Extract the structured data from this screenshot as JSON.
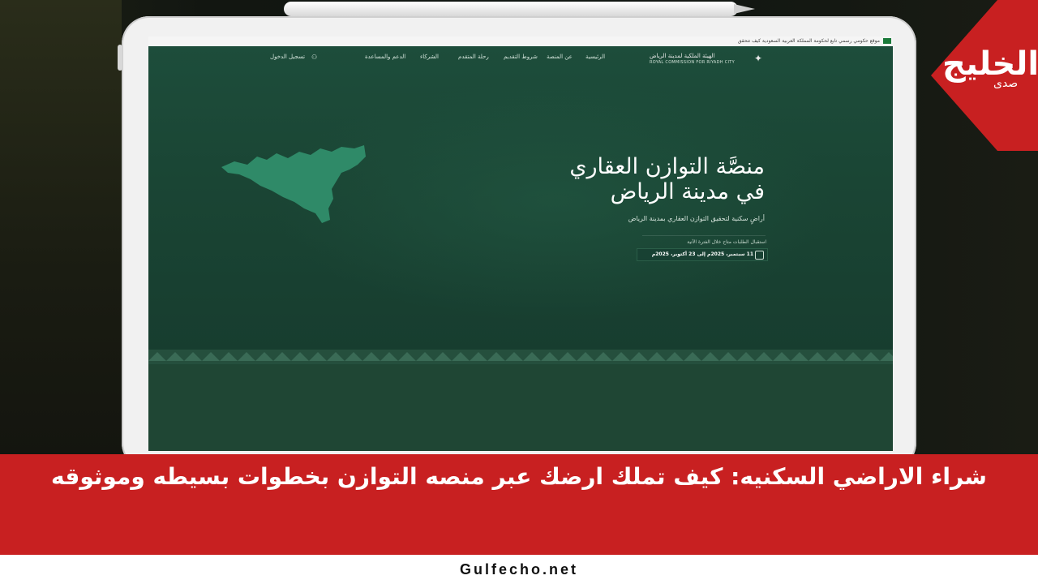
{
  "gov_bar": {
    "text": "موقع حكومي رسمي تابع لحكومة المملكة العربية السعودية  كيف تتحقق"
  },
  "nav": {
    "logo_ar": "الهيئة الملكية لمدينة الرياض",
    "logo_en": "ROYAL COMMISSION FOR RIYADH CITY",
    "items": [
      "الرئيسية",
      "عن المنصة",
      "شروط التقديم",
      "رحلة المتقدم",
      "الشركاء",
      "الدعم والمساعدة"
    ],
    "login": "تسجيل الدخول"
  },
  "hero": {
    "title_line1": "منصَّة التوازن العقاري",
    "title_line2": "في مدينة الرياض",
    "subtitle": "أراضٍ سكنية لتحقيق التوازن العقاري بمدينة الرياض",
    "period_label": "استقبال الطلبات متاح خلال الفترة الآتية",
    "date_range": "11 سبتمبر، 2025م  إلى  23 أكتوبر، 2025م"
  },
  "brand": {
    "name": "الخليج",
    "sub": "صدى"
  },
  "headline": "شراء الاراضي السكنيه: كيف تملك ارضك عبر منصه التوازن بخطوات بسيطه وموثوقه",
  "footer": {
    "site": "Gulfecho.net"
  },
  "colors": {
    "banner_red": "#c82021",
    "screen_green": "#1f4a38",
    "map_green": "#2f8a68"
  }
}
